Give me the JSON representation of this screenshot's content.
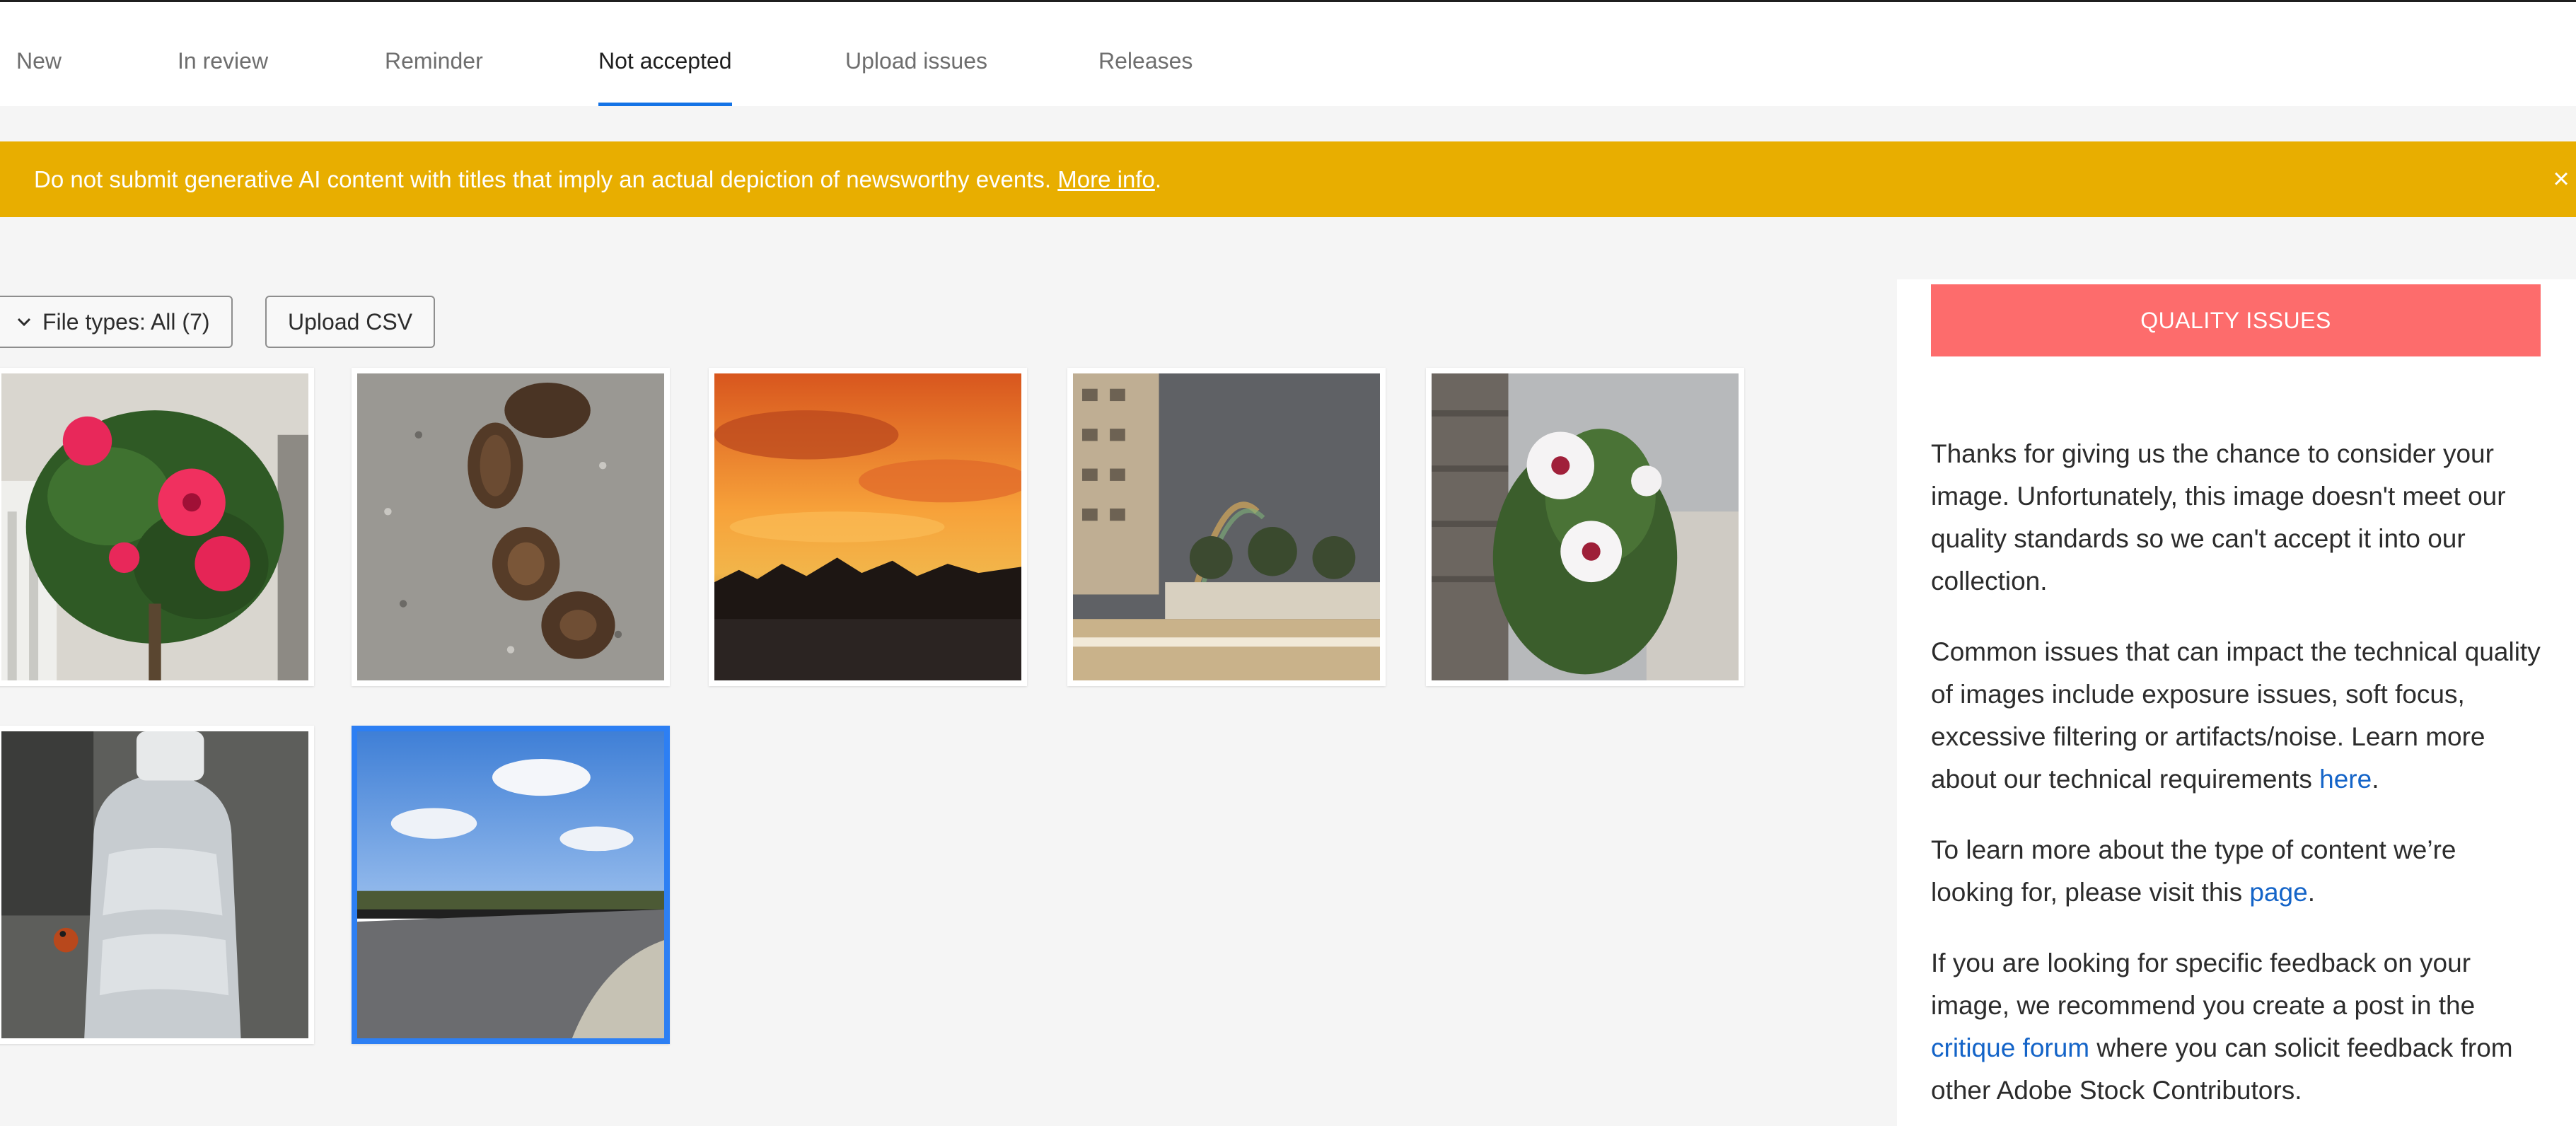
{
  "tabs": [
    {
      "label": "New",
      "active": false
    },
    {
      "label": "In review",
      "active": false
    },
    {
      "label": "Reminder",
      "active": false
    },
    {
      "label": "Not accepted",
      "active": true
    },
    {
      "label": "Upload issues",
      "active": false
    },
    {
      "label": "Releases",
      "active": false
    }
  ],
  "banner": {
    "text": "Do not submit generative AI content with titles that imply an actual depiction of newsworthy events.",
    "link": "More info",
    "after_link": ".",
    "close": "×",
    "color": "#e8ae00"
  },
  "toolbar": {
    "file_types_label": "File types: All (7)",
    "file_types_icon": "chevron-down-icon",
    "upload_csv_label": "Upload CSV"
  },
  "thumbnails": [
    {
      "name": "pink hibiscus flowers",
      "selected": false
    },
    {
      "name": "pine cones on gravel",
      "selected": false
    },
    {
      "name": "orange sunset",
      "selected": false
    },
    {
      "name": "rainbow over building",
      "selected": false
    },
    {
      "name": "white hibiscus flowers",
      "selected": false
    },
    {
      "name": "water bottle with ladybug",
      "selected": false
    },
    {
      "name": "road under blue sky",
      "selected": true
    }
  ],
  "panel": {
    "heading": "QUALITY ISSUES",
    "heading_color": "#fd6c6c",
    "p1": "Thanks for giving us the chance to consider your image. Unfortunately, this image doesn't meet our quality standards so we can't accept it into our collection.",
    "p2": "Common issues that can impact the technical quality of images include exposure issues, soft focus, excessive filtering or artifacts/noise. Learn more about our technical requirements",
    "p2_link": "here",
    "p2_end": ".",
    "p3": "To learn more about the type of content we’re looking for, please visit this",
    "p3_link": "page",
    "p3_end": ".",
    "p4_start": "If you are looking for specific feedback on your image, we recommend you create a post in the",
    "p4_link": "critique forum",
    "p4_end": "where you can solicit feedback from other Adobe Stock Contributors.",
    "link_color": "#1464c8"
  },
  "colors": {
    "accent": "#1473e6",
    "selected_border": "#2d7ff3"
  }
}
